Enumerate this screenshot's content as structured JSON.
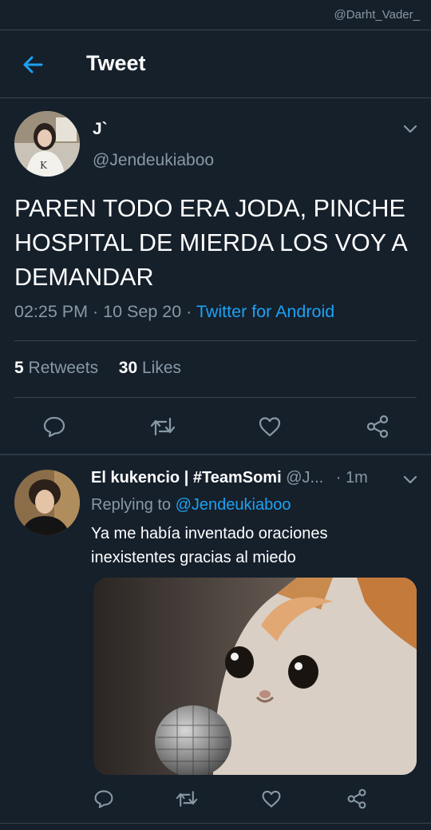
{
  "watermark": "@Darht_Vader_",
  "header": {
    "title": "Tweet"
  },
  "tweet": {
    "author_name": "J`",
    "author_handle": "@Jendeukiaboo",
    "text": "PAREN TODO ERA JODA, PINCHE HOSPITAL DE MIERDA LOS VOY A DEMANDAR",
    "time": "02:25 PM",
    "date": "10 Sep 20",
    "source": "Twitter for Android",
    "retweets": "5",
    "retweets_label": "Retweets",
    "likes": "30",
    "likes_label": "Likes"
  },
  "reply": {
    "author_name": "El kukencio | #TeamSomi",
    "author_handle": "@J...",
    "age": "· 1m",
    "replying_label": "Replying to",
    "replying_to": "@Jendeukiaboo",
    "text": "Ya me había inventado oraciones inexistentes gracias al miedo"
  },
  "colors": {
    "background": "#15202b",
    "accent": "#1da1f2",
    "muted": "#8899a6",
    "divider": "#38444d"
  },
  "icons": [
    "back-arrow-icon",
    "chevron-down-icon",
    "reply-icon",
    "retweet-icon",
    "like-icon",
    "share-icon"
  ]
}
